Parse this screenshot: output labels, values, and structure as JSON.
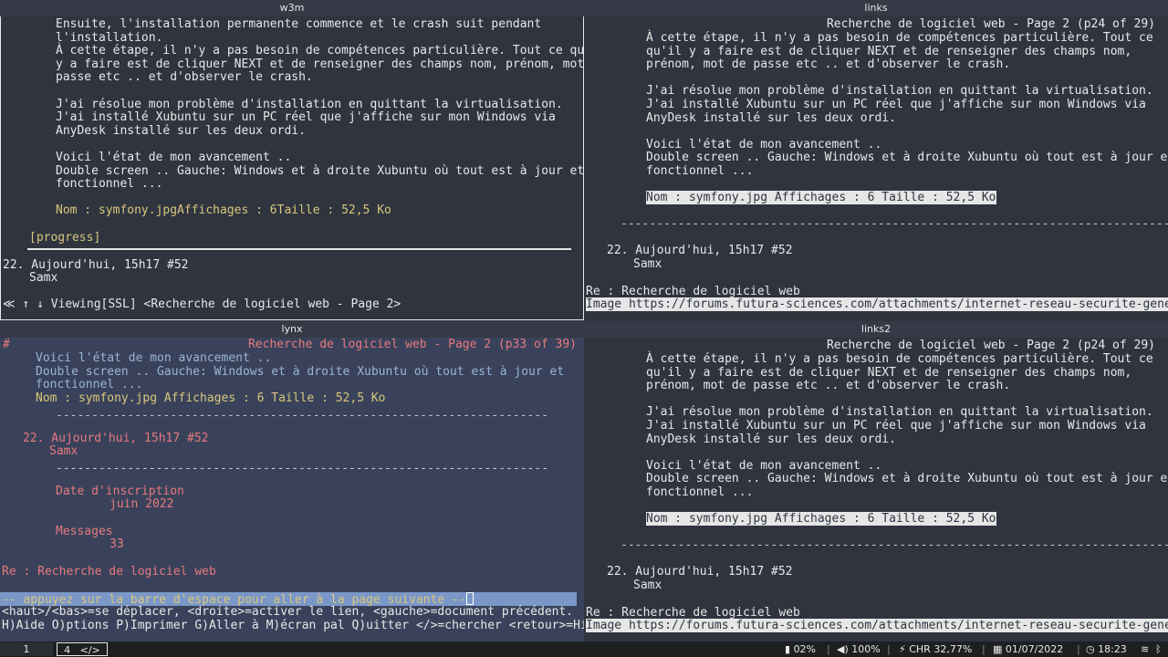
{
  "w3m": {
    "title": "w3m",
    "lines": [
      "Ensuite, l'installation permanente commence et le crash suit pendant",
      "l'installation.",
      "À cette étape, il n'y a pas besoin de compétences particulière. Tout ce qu'il",
      "y a faire est de cliquer NEXT et de renseigner des champs nom, prénom, mot de",
      "passe etc .. et d'observer le crash.",
      "",
      "J'ai résolue mon problème d'installation en quittant la virtualisation.",
      "J'ai installé Xubuntu sur un PC réel que j'affiche sur mon Windows via",
      "AnyDesk installé sur les deux ordi.",
      "",
      "Voici l'état de mon avancement ..",
      "Double screen .. Gauche: Windows et à droite Xubuntu où tout est à jour et",
      "fonctionnel ...",
      "",
      "Nom : symfony.jpgAffichages : 6Taille : 52,5 Ko"
    ],
    "progress": "[progress]",
    "post_number": "22. Aujourd'hui, 15h17 #52",
    "post_author": "Samx",
    "status": "≪ ↑ ↓ Viewing[SSL] <Recherche de logiciel web - Page 2>"
  },
  "links": {
    "title": "links",
    "page_title": "Recherche de logiciel web - Page 2 (p24 of 29)",
    "lines": [
      "À cette étape, il n'y a pas besoin de compétences particulière. Tout ce",
      "qu'il y a faire est de cliquer NEXT et de renseigner des champs nom,",
      "prénom, mot de passe etc .. et d'observer le crash.",
      "",
      "J'ai résolue mon problème d'installation en quittant la virtualisation.",
      "J'ai installé Xubuntu sur un PC réel que j'affiche sur mon Windows via",
      "AnyDesk installé sur les deux ordi.",
      "",
      "Voici l'état de mon avancement ..",
      "Double screen .. Gauche: Windows et à droite Xubuntu où tout est à jour et",
      "fonctionnel ..."
    ],
    "image_caption": "Nom : symfony.jpg Affichages : 6 Taille : 52,5 Ko",
    "post_number": "22. Aujourd'hui, 15h17 #52",
    "post_author": "Samx",
    "reply_title": "Re : Recherche de logiciel web",
    "status_url": "Image https://forums.futura-sciences.com/attachments/internet-reseau-securite-general"
  },
  "lynx": {
    "title": "lynx",
    "hash": "#",
    "page_title": "Recherche de logiciel web - Page 2 (p33 of 39)",
    "lines": [
      "Voici l'état de mon avancement ..",
      "Double screen .. Gauche: Windows et à droite Xubuntu où tout est à jour et",
      "fonctionnel ..."
    ],
    "image_caption": "Nom : symfony.jpg Affichages : 6 Taille : 52,5 Ko",
    "post_number": "22. Aujourd'hui, 15h17 #52",
    "post_author": "Samx",
    "join_label": "Date d'inscription",
    "join_value": "juin 2022",
    "messages_label": "Messages",
    "messages_value": "33",
    "reply_title": "Re : Recherche de logiciel web",
    "prompt": "-- appuyez sur la barre d'espace pour aller à la page suivante --",
    "help1": "<haut>/<bas>=se déplacer, <droite>=activer le lien, <gauche>=document précédent.",
    "help2": "H)Aide O)ptions P)Imprimer G)Aller à M)écran pal Q)uitter </>=chercher <retour>=Histo."
  },
  "links2": {
    "title": "links2",
    "page_title": "Recherche de logiciel web - Page 2 (p24 of 29)",
    "lines": [
      "À cette étape, il n'y a pas besoin de compétences particulière. Tout ce",
      "qu'il y a faire est de cliquer NEXT et de renseigner des champs nom,",
      "prénom, mot de passe etc .. et d'observer le crash.",
      "",
      "J'ai résolue mon problème d'installation en quittant la virtualisation.",
      "J'ai installé Xubuntu sur un PC réel que j'affiche sur mon Windows via",
      "AnyDesk installé sur les deux ordi.",
      "",
      "Voici l'état de mon avancement ..",
      "Double screen .. Gauche: Windows et à droite Xubuntu où tout est à jour et",
      "fonctionnel ..."
    ],
    "image_caption": "Nom : symfony.jpg Affichages : 6 Taille : 52,5 Ko",
    "post_number": "22. Aujourd'hui, 15h17 #52",
    "post_author": "Samx",
    "reply_title": "Re : Recherche de logiciel web",
    "status_url": "Image https://forums.futura-sciences.com/attachments/internet-reseau-securite-general"
  },
  "bar": {
    "ws1": "1",
    "ws4": "4",
    "ws4_icon": "</>",
    "disk": "02%",
    "volume": "100%",
    "battery": "CHR 32,77%",
    "date": "01/07/2022",
    "time": "18:23"
  }
}
